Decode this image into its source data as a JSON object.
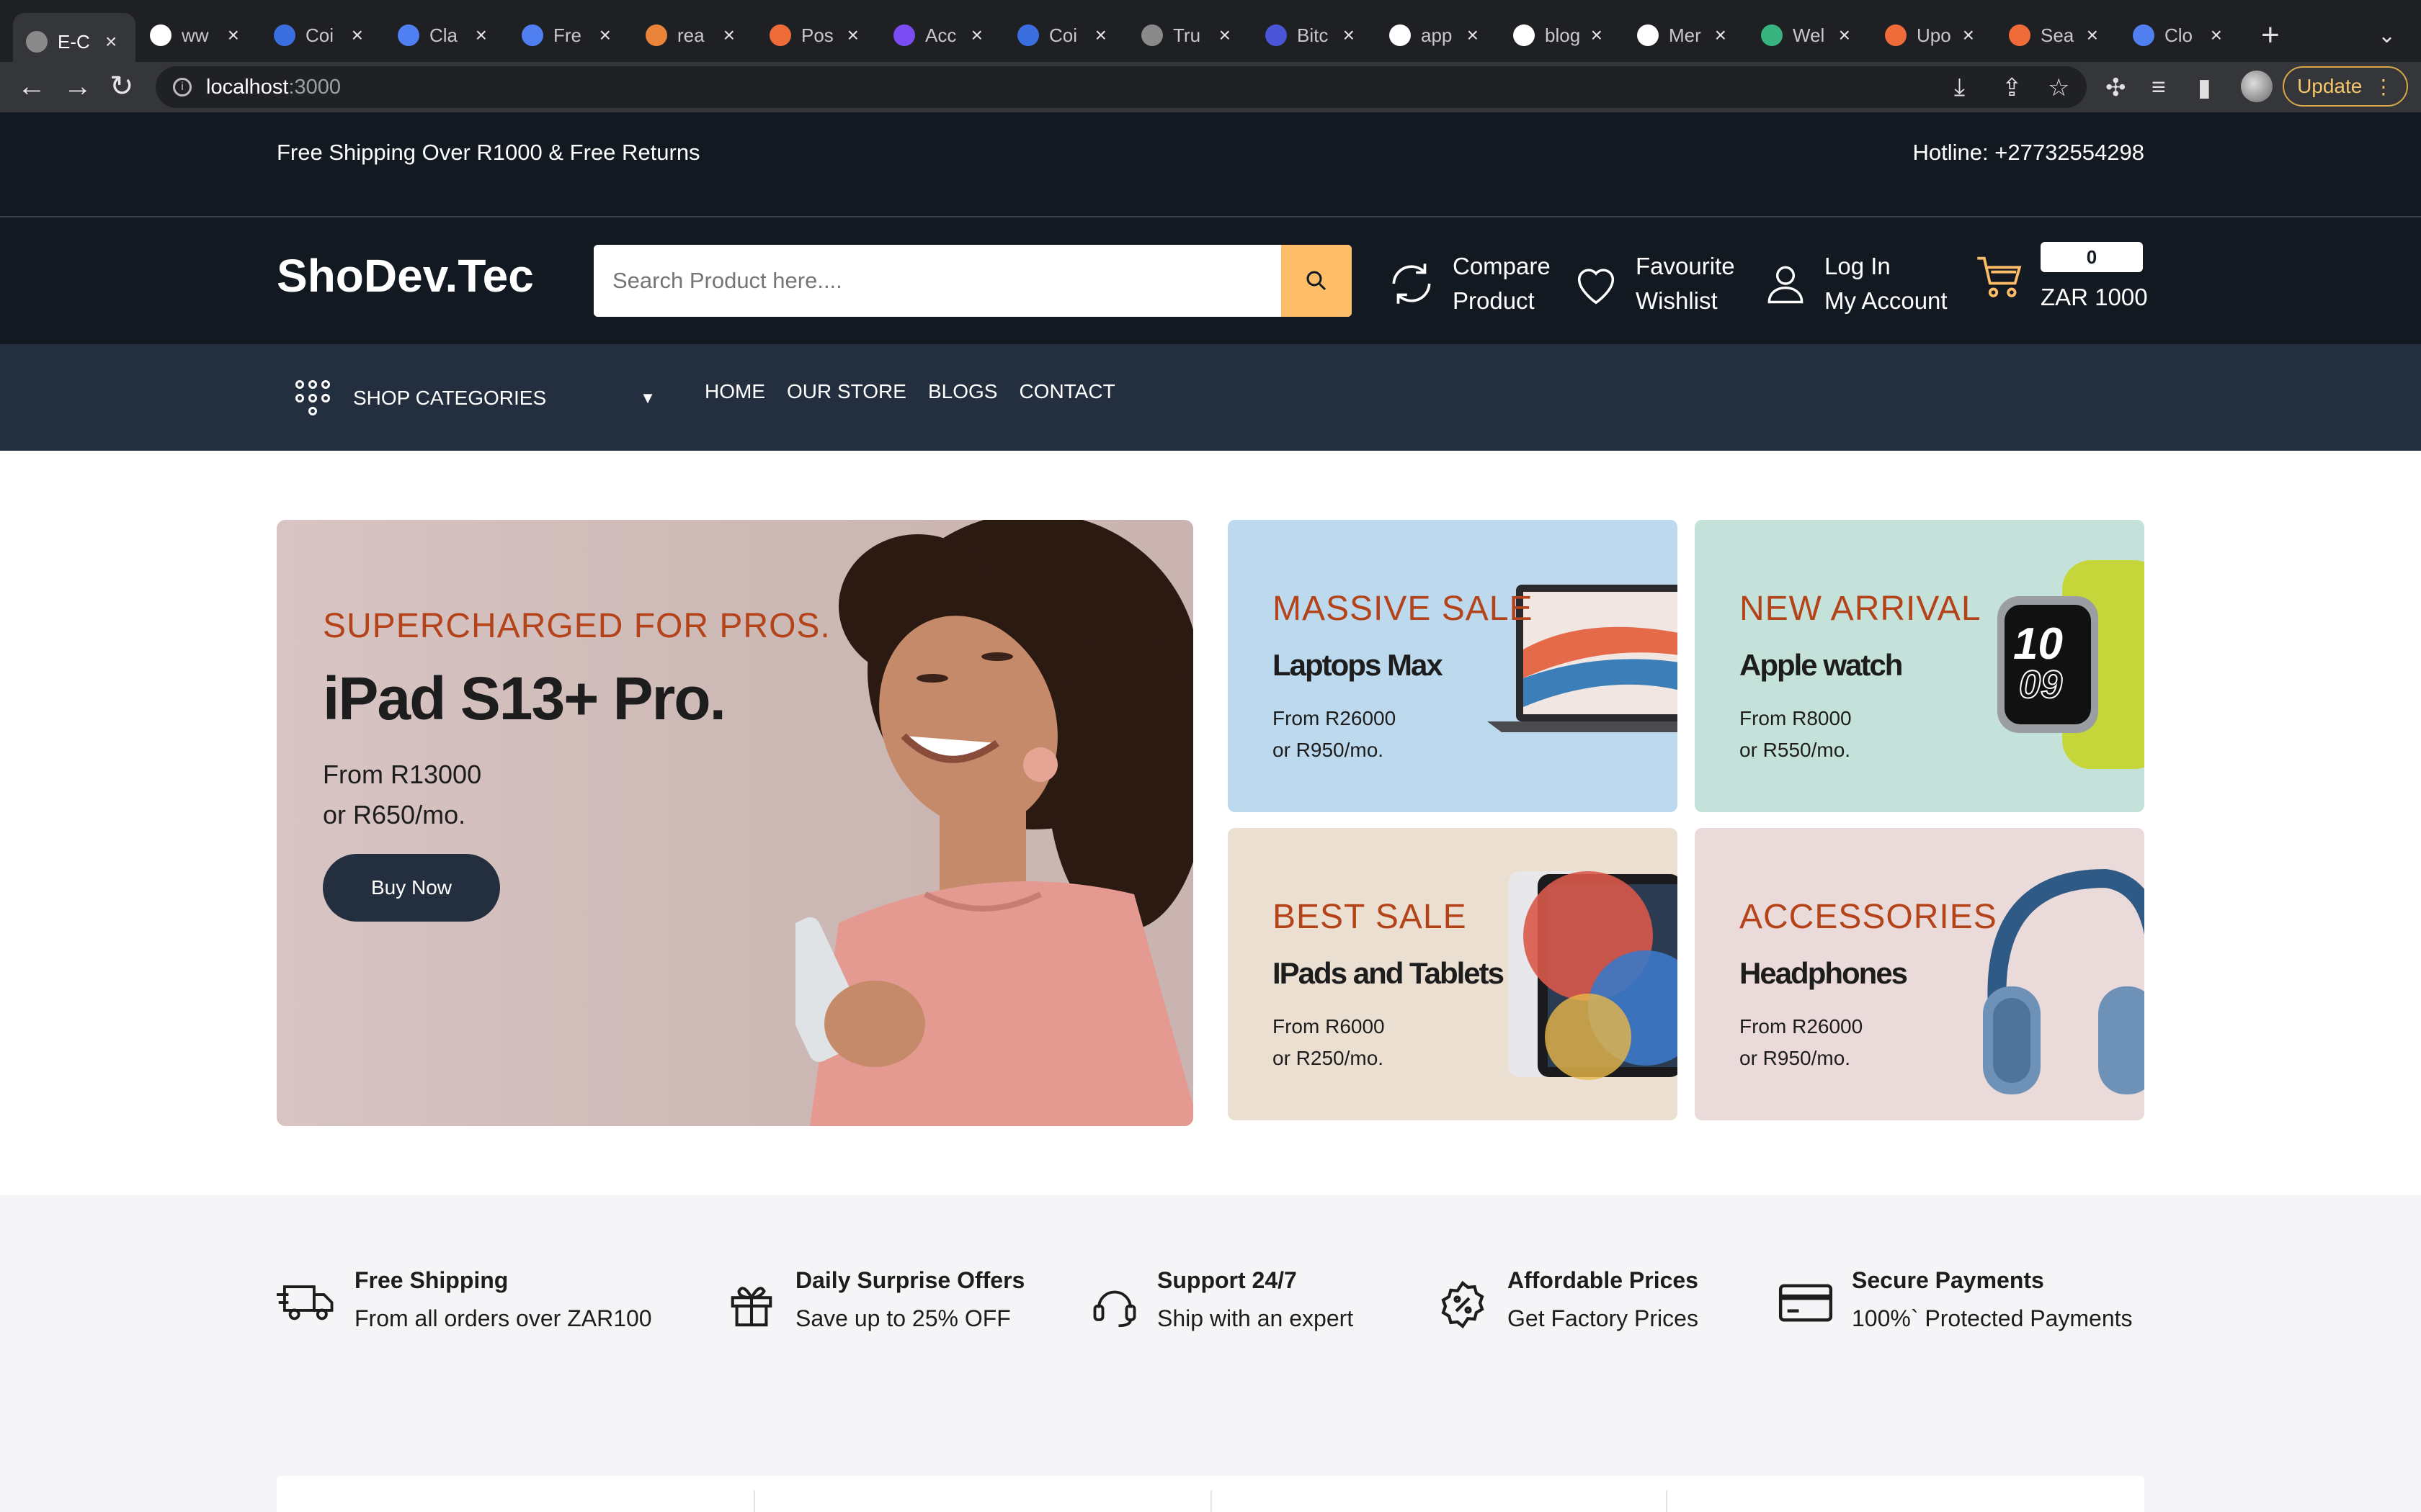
{
  "browser": {
    "tabs": [
      {
        "title": "E-C",
        "color": "#8a8a8a"
      },
      {
        "title": "ww",
        "color": "#ffffff"
      },
      {
        "title": "Coi",
        "color": "#3b6fe0"
      },
      {
        "title": "Cla",
        "color": "#4f7ff0"
      },
      {
        "title": "Fre",
        "color": "#4f7ff0"
      },
      {
        "title": "rea",
        "color": "#e9843a"
      },
      {
        "title": "Pos",
        "color": "#ef6b3a"
      },
      {
        "title": "Acc",
        "color": "#7b4cf2"
      },
      {
        "title": "Coi",
        "color": "#3b6fe0"
      },
      {
        "title": "Tru",
        "color": "#8a8a8a"
      },
      {
        "title": "Bitc",
        "color": "#4b55d8"
      },
      {
        "title": "app",
        "color": "#ffffff"
      },
      {
        "title": "blog",
        "color": "#ffffff"
      },
      {
        "title": "Mer",
        "color": "#ffffff"
      },
      {
        "title": "Wel",
        "color": "#36b37e"
      },
      {
        "title": "Upo",
        "color": "#ef6b3a"
      },
      {
        "title": "Sea",
        "color": "#ef6b3a"
      },
      {
        "title": "Clo",
        "color": "#4f7ff0"
      }
    ],
    "url_host": "localhost",
    "url_port": ":3000",
    "update_label": "Update"
  },
  "header": {
    "shipping_note": "Free Shipping Over R1000 & Free Returns",
    "hotline": "Hotline: +27732554298",
    "logo": "ShoDev.Tec",
    "search_placeholder": "Search Product here....",
    "compare_line1": "Compare",
    "compare_line2": "Product",
    "wishlist_line1": "Favourite",
    "wishlist_line2": "Wishlist",
    "account_line1": "Log In",
    "account_line2": "My Account",
    "cart_count": "0",
    "cart_total": "ZAR 1000"
  },
  "nav": {
    "categories_label": "SHOP CATEGORIES",
    "links": [
      "HOME",
      "OUR STORE",
      "BLOGS",
      "CONTACT"
    ]
  },
  "main_banner": {
    "kicker": "SUPERCHARGED FOR PROS.",
    "title": "iPad S13+ Pro.",
    "price_line1": "From R13000",
    "price_line2": "or R650/mo.",
    "button": "Buy Now"
  },
  "small_banners": [
    {
      "kicker": "MASSIVE SALE",
      "title": "Laptops Max",
      "price_line1": "From R26000",
      "price_line2": "or R950/mo.",
      "bg": "#bcd9ee"
    },
    {
      "kicker": "NEW ARRIVAL",
      "title": "Apple watch",
      "price_line1": "From R8000",
      "price_line2": "or R550/mo.",
      "bg": "#c5e2da"
    },
    {
      "kicker": "BEST SALE",
      "title": "IPads and Tablets",
      "price_line1": "From R6000",
      "price_line2": "or R250/mo.",
      "bg": "#ebdfd2"
    },
    {
      "kicker": "ACCESSORIES",
      "title": "Headphones",
      "price_line1": "From R26000",
      "price_line2": "or R950/mo.",
      "bg": "#ebdada"
    }
  ],
  "watch_face": {
    "hour": "10",
    "minute": "09"
  },
  "services": [
    {
      "title": "Free Shipping",
      "desc": "From all orders over ZAR100"
    },
    {
      "title": "Daily Surprise Offers",
      "desc": "Save up to 25% OFF"
    },
    {
      "title": "Support 24/7",
      "desc": "Ship with an expert"
    },
    {
      "title": "Affordable Prices",
      "desc": "Get Factory Prices"
    },
    {
      "title": "Secure Payments",
      "desc": "100%` Protected Payments"
    }
  ],
  "colors": {
    "header_bg": "#131921",
    "nav_bg": "#232f3e",
    "accent": "#febd69",
    "kicker": "#b5431a"
  }
}
